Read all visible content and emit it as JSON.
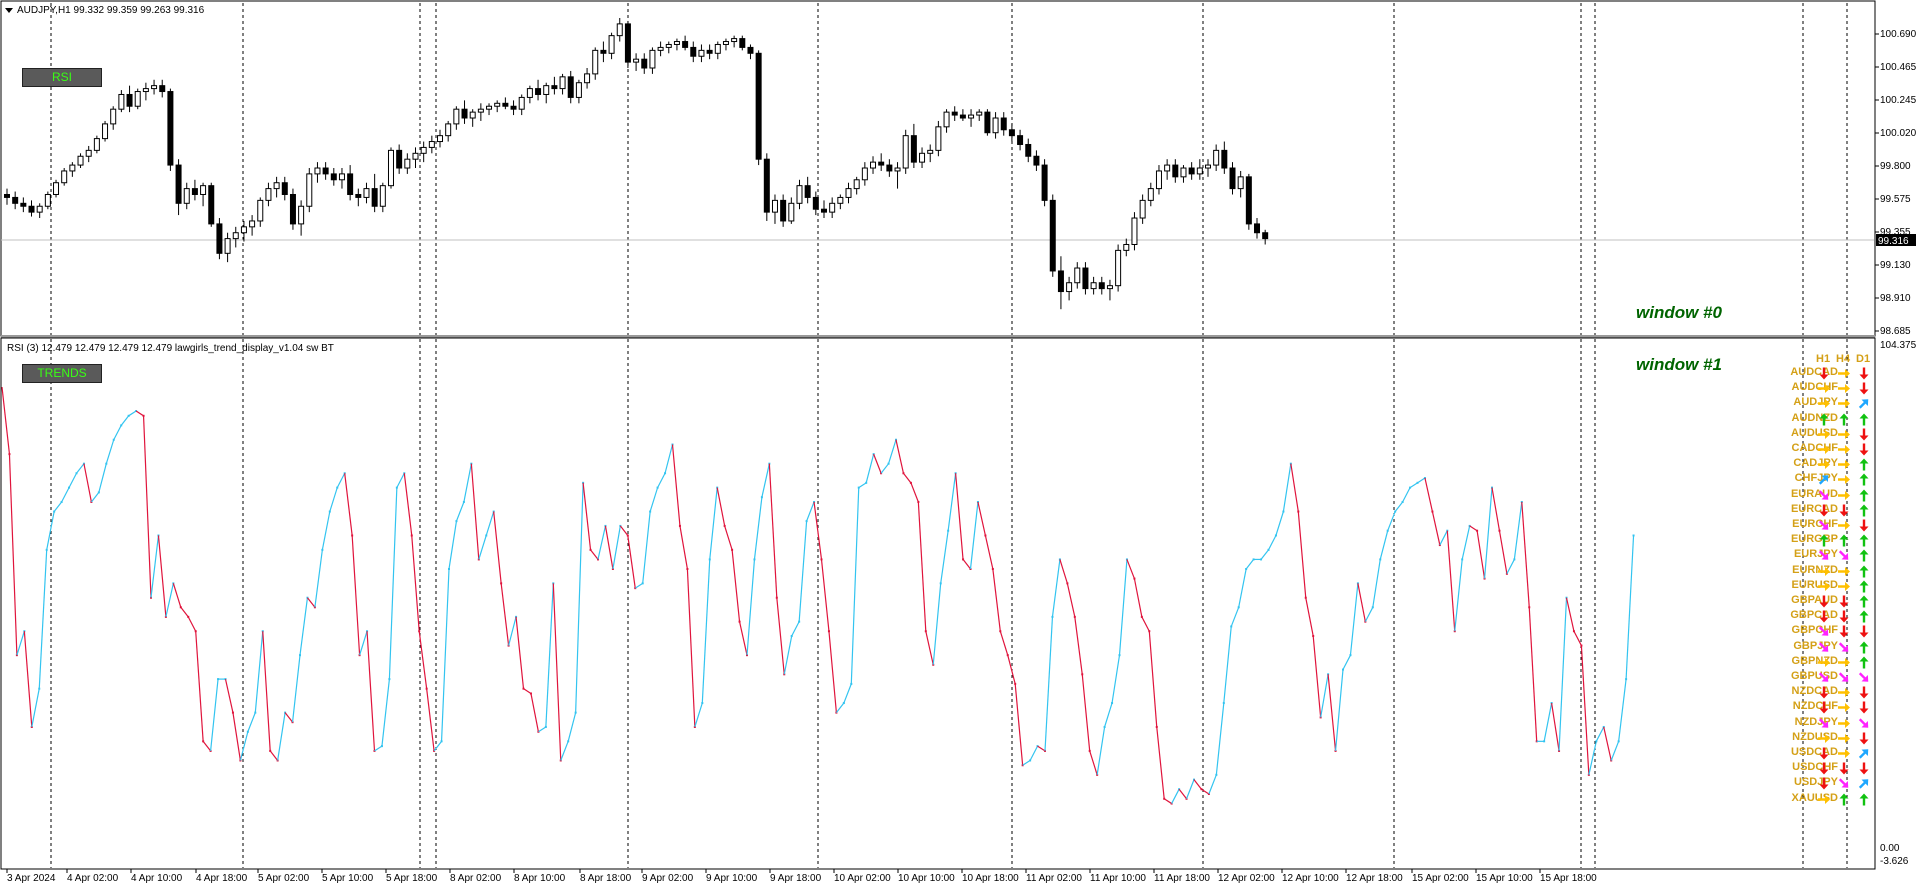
{
  "chart_title": "AUDJPY,H1  99.332 99.359 99.263 99.316",
  "indicator_title": "RSI (3) 12.479 12.479 12.479 12.479  lawgirls_trend_display_v1.04 sw BT",
  "buttons": {
    "rsi": "RSI",
    "trends": "TRENDS"
  },
  "windows": {
    "main": "window #0",
    "sub": "window #1"
  },
  "price_axis": {
    "labels": [
      "100.690",
      "100.465",
      "100.245",
      "100.020",
      "99.800",
      "99.575",
      "99.355",
      "99.130",
      "98.910",
      "98.685"
    ],
    "current_price": "99.316"
  },
  "rsi_axis": {
    "top": "104.375",
    "zero": "0.00",
    "bottom": "-3.626"
  },
  "time_axis": [
    "3 Apr 2024",
    "4 Apr 02:00",
    "4 Apr 10:00",
    "4 Apr 18:00",
    "5 Apr 02:00",
    "5 Apr 10:00",
    "5 Apr 18:00",
    "8 Apr 02:00",
    "8 Apr 10:00",
    "8 Apr 18:00",
    "9 Apr 02:00",
    "9 Apr 10:00",
    "9 Apr 18:00",
    "10 Apr 02:00",
    "10 Apr 10:00",
    "10 Apr 18:00",
    "11 Apr 02:00",
    "11 Apr 10:00",
    "11 Apr 18:00",
    "12 Apr 02:00",
    "12 Apr 10:00",
    "12 Apr 18:00",
    "15 Apr 02:00",
    "15 Apr 10:00",
    "15 Apr 18:00"
  ],
  "trend_panel": {
    "headers": [
      "H1",
      "H4",
      "D1"
    ],
    "rows": [
      {
        "symbol": "AUDCAD",
        "arrows": [
          "down",
          "right",
          "down"
        ]
      },
      {
        "symbol": "AUDCHF",
        "arrows": [
          "right",
          "right",
          "down"
        ]
      },
      {
        "symbol": "AUDJPY",
        "arrows": [
          "right",
          "right",
          "up-right"
        ]
      },
      {
        "symbol": "AUDNZD",
        "arrows": [
          "up",
          "up",
          "up"
        ]
      },
      {
        "symbol": "AUDUSD",
        "arrows": [
          "right",
          "right",
          "down"
        ]
      },
      {
        "symbol": "CADCHF",
        "arrows": [
          "right",
          "right",
          "down"
        ]
      },
      {
        "symbol": "CADJPY",
        "arrows": [
          "right",
          "right",
          "up"
        ]
      },
      {
        "symbol": "CHFJPY",
        "arrows": [
          "up-right",
          "right",
          "up"
        ]
      },
      {
        "symbol": "EURAUD",
        "arrows": [
          "down-right",
          "right",
          "up"
        ]
      },
      {
        "symbol": "EURCAD",
        "arrows": [
          "down",
          "down",
          "up"
        ]
      },
      {
        "symbol": "EURCHF",
        "arrows": [
          "down-right",
          "right",
          "down"
        ]
      },
      {
        "symbol": "EURGBP",
        "arrows": [
          "up",
          "up",
          "up"
        ]
      },
      {
        "symbol": "EURJPY",
        "arrows": [
          "down-right",
          "down-right",
          "up"
        ]
      },
      {
        "symbol": "EURNZD",
        "arrows": [
          "right",
          "right",
          "up"
        ]
      },
      {
        "symbol": "EURUSD",
        "arrows": [
          "right",
          "right",
          "up"
        ]
      },
      {
        "symbol": "GBPAUD",
        "arrows": [
          "down",
          "down",
          "up"
        ]
      },
      {
        "symbol": "GBPCAD",
        "arrows": [
          "down",
          "down",
          "up"
        ]
      },
      {
        "symbol": "GBPCHF",
        "arrows": [
          "down-right",
          "down",
          "down"
        ]
      },
      {
        "symbol": "GBPJPY",
        "arrows": [
          "down-right",
          "down-right",
          "up"
        ]
      },
      {
        "symbol": "GBPNZD",
        "arrows": [
          "right",
          "right",
          "up"
        ]
      },
      {
        "symbol": "GBPUSD",
        "arrows": [
          "down-right",
          "down-right",
          "down-right"
        ]
      },
      {
        "symbol": "NZDCAD",
        "arrows": [
          "down",
          "right",
          "down"
        ]
      },
      {
        "symbol": "NZDCHF",
        "arrows": [
          "down",
          "right",
          "down"
        ]
      },
      {
        "symbol": "NZDJPY",
        "arrows": [
          "down-right",
          "right",
          "down-right"
        ]
      },
      {
        "symbol": "NZDUSD",
        "arrows": [
          "right",
          "right",
          "down"
        ]
      },
      {
        "symbol": "USDCAD",
        "arrows": [
          "down",
          "right",
          "up-right"
        ]
      },
      {
        "symbol": "USDCHF",
        "arrows": [
          "down",
          "down",
          "down"
        ]
      },
      {
        "symbol": "USDJPY",
        "arrows": [
          "down",
          "down-right",
          "up-right"
        ]
      },
      {
        "symbol": "XAUUSD",
        "arrows": [
          "right",
          "up",
          "up"
        ]
      }
    ]
  },
  "colors": {
    "up": "#11c211",
    "down": "#ee1111",
    "right": "#ffc000",
    "up-right": "#1ea7ff",
    "down-right": "#ff22ff",
    "rsi_up": "#33c4f0",
    "rsi_down": "#e0143c"
  },
  "chart_data": {
    "type": "candlestick",
    "price_ylim": [
      98.685,
      100.82
    ],
    "rsi_ylim": [
      -3.626,
      104.375
    ],
    "candles": [
      [
        99.62,
        99.66,
        99.55,
        99.6
      ],
      [
        99.6,
        99.64,
        99.52,
        99.56
      ],
      [
        99.56,
        99.6,
        99.5,
        99.54
      ],
      [
        99.54,
        99.58,
        99.47,
        99.5
      ],
      [
        99.5,
        99.56,
        99.46,
        99.54
      ],
      [
        99.54,
        99.64,
        99.52,
        99.62
      ],
      [
        99.62,
        99.72,
        99.6,
        99.7
      ],
      [
        99.7,
        99.8,
        99.68,
        99.78
      ],
      [
        99.78,
        99.84,
        99.74,
        99.82
      ],
      [
        99.82,
        99.9,
        99.8,
        99.88
      ],
      [
        99.88,
        99.95,
        99.84,
        99.92
      ],
      [
        99.92,
        100.02,
        99.9,
        100.0
      ],
      [
        100.0,
        100.12,
        99.98,
        100.1
      ],
      [
        100.1,
        100.22,
        100.06,
        100.2
      ],
      [
        100.2,
        100.33,
        100.18,
        100.3
      ],
      [
        100.3,
        100.36,
        100.18,
        100.22
      ],
      [
        100.22,
        100.34,
        100.2,
        100.32
      ],
      [
        100.32,
        100.38,
        100.26,
        100.34
      ],
      [
        100.34,
        100.4,
        100.3,
        100.36
      ],
      [
        100.36,
        100.4,
        100.28,
        100.32
      ],
      [
        100.32,
        100.34,
        99.78,
        99.82
      ],
      [
        99.82,
        99.86,
        99.48,
        99.56
      ],
      [
        99.56,
        99.7,
        99.52,
        99.66
      ],
      [
        99.66,
        99.72,
        99.58,
        99.62
      ],
      [
        99.62,
        99.7,
        99.54,
        99.68
      ],
      [
        99.68,
        99.7,
        99.4,
        99.42
      ],
      [
        99.42,
        99.46,
        99.18,
        99.22
      ],
      [
        99.22,
        99.36,
        99.16,
        99.32
      ],
      [
        99.32,
        99.4,
        99.26,
        99.36
      ],
      [
        99.36,
        99.44,
        99.3,
        99.4
      ],
      [
        99.4,
        99.48,
        99.34,
        99.44
      ],
      [
        99.44,
        99.6,
        99.4,
        99.58
      ],
      [
        99.58,
        99.7,
        99.54,
        99.66
      ],
      [
        99.66,
        99.74,
        99.6,
        99.7
      ],
      [
        99.7,
        99.74,
        99.58,
        99.62
      ],
      [
        99.62,
        99.66,
        99.38,
        99.42
      ],
      [
        99.42,
        99.58,
        99.34,
        99.54
      ],
      [
        99.54,
        99.8,
        99.5,
        99.76
      ],
      [
        99.76,
        99.84,
        99.7,
        99.8
      ],
      [
        99.8,
        99.84,
        99.72,
        99.76
      ],
      [
        99.76,
        99.8,
        99.68,
        99.72
      ],
      [
        99.72,
        99.8,
        99.66,
        99.76
      ],
      [
        99.76,
        99.82,
        99.58,
        99.62
      ],
      [
        99.62,
        99.66,
        99.54,
        99.6
      ],
      [
        99.6,
        99.7,
        99.56,
        99.66
      ],
      [
        99.66,
        99.76,
        99.5,
        99.54
      ],
      [
        99.54,
        99.7,
        99.5,
        99.68
      ],
      [
        99.68,
        99.94,
        99.66,
        99.92
      ],
      [
        99.92,
        99.96,
        99.76,
        99.8
      ],
      [
        99.8,
        99.9,
        99.76,
        99.86
      ],
      [
        99.86,
        99.94,
        99.8,
        99.9
      ],
      [
        99.9,
        99.98,
        99.84,
        99.94
      ],
      [
        99.94,
        100.02,
        99.9,
        99.98
      ],
      [
        99.98,
        100.06,
        99.94,
        100.02
      ],
      [
        100.02,
        100.12,
        99.98,
        100.1
      ],
      [
        100.1,
        100.22,
        100.06,
        100.2
      ],
      [
        100.2,
        100.26,
        100.1,
        100.14
      ],
      [
        100.14,
        100.2,
        100.08,
        100.18
      ],
      [
        100.18,
        100.24,
        100.12,
        100.2
      ],
      [
        100.2,
        100.24,
        100.16,
        100.22
      ],
      [
        100.22,
        100.26,
        100.18,
        100.24
      ],
      [
        100.24,
        100.28,
        100.2,
        100.22
      ],
      [
        100.22,
        100.26,
        100.16,
        100.2
      ],
      [
        100.2,
        100.3,
        100.16,
        100.28
      ],
      [
        100.28,
        100.36,
        100.24,
        100.34
      ],
      [
        100.34,
        100.4,
        100.26,
        100.3
      ],
      [
        100.3,
        100.38,
        100.24,
        100.36
      ],
      [
        100.36,
        100.42,
        100.3,
        100.34
      ],
      [
        100.34,
        100.44,
        100.3,
        100.42
      ],
      [
        100.42,
        100.46,
        100.24,
        100.28
      ],
      [
        100.28,
        100.4,
        100.24,
        100.38
      ],
      [
        100.38,
        100.48,
        100.34,
        100.44
      ],
      [
        100.44,
        100.62,
        100.4,
        100.6
      ],
      [
        100.6,
        100.66,
        100.52,
        100.58
      ],
      [
        100.58,
        100.72,
        100.54,
        100.7
      ],
      [
        100.7,
        100.82,
        100.66,
        100.78
      ],
      [
        100.78,
        100.8,
        100.48,
        100.52
      ],
      [
        100.52,
        100.58,
        100.46,
        100.54
      ],
      [
        100.54,
        100.58,
        100.44,
        100.48
      ],
      [
        100.48,
        100.62,
        100.44,
        100.6
      ],
      [
        100.6,
        100.66,
        100.56,
        100.62
      ],
      [
        100.62,
        100.66,
        100.58,
        100.64
      ],
      [
        100.64,
        100.68,
        100.6,
        100.66
      ],
      [
        100.66,
        100.7,
        100.6,
        100.62
      ],
      [
        100.62,
        100.66,
        100.52,
        100.56
      ],
      [
        100.56,
        100.64,
        100.52,
        100.6
      ],
      [
        100.6,
        100.64,
        100.54,
        100.58
      ],
      [
        100.58,
        100.66,
        100.54,
        100.64
      ],
      [
        100.64,
        100.68,
        100.6,
        100.66
      ],
      [
        100.66,
        100.7,
        100.62,
        100.68
      ],
      [
        100.68,
        100.7,
        100.6,
        100.62
      ],
      [
        100.62,
        100.64,
        100.54,
        100.58
      ],
      [
        100.58,
        100.6,
        99.82,
        99.86
      ],
      [
        99.86,
        99.9,
        99.44,
        99.5
      ],
      [
        99.5,
        99.62,
        99.42,
        99.58
      ],
      [
        99.58,
        99.62,
        99.4,
        99.44
      ],
      [
        99.44,
        99.6,
        99.42,
        99.56
      ],
      [
        99.56,
        99.72,
        99.52,
        99.68
      ],
      [
        99.68,
        99.74,
        99.56,
        99.6
      ],
      [
        99.6,
        99.64,
        99.48,
        99.52
      ],
      [
        99.52,
        99.58,
        99.46,
        99.5
      ],
      [
        99.5,
        99.6,
        99.46,
        99.56
      ],
      [
        99.56,
        99.62,
        99.52,
        99.6
      ],
      [
        99.6,
        99.7,
        99.56,
        99.66
      ],
      [
        99.66,
        99.74,
        99.62,
        99.72
      ],
      [
        99.72,
        99.84,
        99.68,
        99.8
      ],
      [
        99.8,
        99.88,
        99.76,
        99.84
      ],
      [
        99.84,
        99.9,
        99.78,
        99.82
      ],
      [
        99.82,
        99.86,
        99.74,
        99.78
      ],
      [
        99.78,
        99.84,
        99.66,
        99.8
      ],
      [
        99.8,
        100.06,
        99.76,
        100.02
      ],
      [
        100.02,
        100.1,
        99.8,
        99.84
      ],
      [
        99.84,
        99.94,
        99.8,
        99.9
      ],
      [
        99.9,
        99.96,
        99.84,
        99.92
      ],
      [
        99.92,
        100.12,
        99.88,
        100.08
      ],
      [
        100.08,
        100.2,
        100.04,
        100.18
      ],
      [
        100.18,
        100.22,
        100.12,
        100.16
      ],
      [
        100.16,
        100.2,
        100.12,
        100.14
      ],
      [
        100.14,
        100.2,
        100.08,
        100.16
      ],
      [
        100.16,
        100.2,
        100.12,
        100.18
      ],
      [
        100.18,
        100.2,
        100.02,
        100.04
      ],
      [
        100.04,
        100.18,
        100.0,
        100.14
      ],
      [
        100.14,
        100.18,
        100.02,
        100.06
      ],
      [
        100.06,
        100.1,
        99.98,
        100.02
      ],
      [
        100.02,
        100.06,
        99.92,
        99.96
      ],
      [
        99.96,
        100.0,
        99.84,
        99.88
      ],
      [
        99.88,
        99.92,
        99.78,
        99.82
      ],
      [
        99.82,
        99.86,
        99.54,
        99.58
      ],
      [
        99.58,
        99.62,
        99.06,
        99.1
      ],
      [
        99.1,
        99.2,
        98.84,
        98.96
      ],
      [
        98.96,
        99.06,
        98.9,
        99.02
      ],
      [
        99.02,
        99.16,
        98.98,
        99.12
      ],
      [
        99.12,
        99.16,
        98.94,
        98.98
      ],
      [
        98.98,
        99.06,
        98.94,
        99.02
      ],
      [
        99.02,
        99.06,
        98.94,
        98.98
      ],
      [
        98.98,
        99.04,
        98.9,
        99.0
      ],
      [
        99.0,
        99.28,
        98.96,
        99.24
      ],
      [
        99.24,
        99.32,
        99.2,
        99.28
      ],
      [
        99.28,
        99.5,
        99.24,
        99.46
      ],
      [
        99.46,
        99.62,
        99.42,
        99.58
      ],
      [
        99.58,
        99.7,
        99.54,
        99.66
      ],
      [
        99.66,
        99.82,
        99.62,
        99.78
      ],
      [
        99.78,
        99.86,
        99.72,
        99.82
      ],
      [
        99.82,
        99.86,
        99.7,
        99.74
      ],
      [
        99.74,
        99.82,
        99.7,
        99.8
      ],
      [
        99.8,
        99.84,
        99.72,
        99.76
      ],
      [
        99.76,
        99.86,
        99.72,
        99.8
      ],
      [
        99.8,
        99.86,
        99.74,
        99.82
      ],
      [
        99.82,
        99.96,
        99.78,
        99.92
      ],
      [
        99.92,
        99.98,
        99.76,
        99.8
      ],
      [
        99.8,
        99.84,
        99.62,
        99.66
      ],
      [
        99.66,
        99.78,
        99.6,
        99.74
      ],
      [
        99.74,
        99.76,
        99.38,
        99.42
      ],
      [
        99.42,
        99.46,
        99.32,
        99.36
      ],
      [
        99.36,
        99.38,
        99.28,
        99.32
      ]
    ],
    "rsi": [
      96,
      82,
      40,
      45,
      25,
      33,
      62,
      70,
      72,
      75,
      78,
      80,
      72,
      74,
      80,
      85,
      88,
      90,
      91,
      90,
      52,
      65,
      48,
      55,
      50,
      48,
      45,
      22,
      20,
      35,
      35,
      28,
      18,
      24,
      28,
      45,
      20,
      18,
      28,
      26,
      40,
      52,
      50,
      62,
      70,
      75,
      78,
      65,
      40,
      45,
      20,
      21,
      35,
      75,
      78,
      65,
      45,
      33,
      20,
      22,
      58,
      68,
      72,
      80,
      60,
      65,
      70,
      55,
      42,
      48,
      33,
      32,
      24,
      25,
      55,
      18,
      22,
      28,
      76,
      62,
      60,
      67,
      58,
      67,
      65,
      54,
      55,
      70,
      75,
      78,
      84,
      67,
      58,
      25,
      30,
      60,
      75,
      67,
      62,
      47,
      40,
      60,
      73,
      80,
      52,
      36,
      44,
      47,
      68,
      72,
      60,
      45,
      28,
      30,
      34,
      75,
      76,
      82,
      78,
      80,
      85,
      78,
      76,
      72,
      45,
      38,
      55,
      66,
      78,
      60,
      58,
      72,
      65,
      58,
      45,
      40,
      34,
      17,
      18,
      21,
      20,
      48,
      60,
      55,
      48,
      36,
      20,
      15,
      25,
      30,
      40,
      60,
      56,
      48,
      45,
      25,
      10,
      9,
      12,
      10,
      14,
      12,
      11,
      15,
      30,
      46,
      50,
      58,
      60,
      60,
      62,
      65,
      70,
      80,
      70,
      52,
      44,
      27,
      36,
      20,
      37,
      40,
      55,
      47,
      50,
      60,
      66,
      70,
      72,
      75,
      76,
      77,
      70,
      63,
      66,
      45,
      60,
      67,
      66,
      56,
      75,
      66,
      57,
      60,
      72,
      50,
      22,
      22,
      30,
      20,
      52,
      45,
      42,
      15,
      22,
      25,
      18,
      22,
      35,
      65
    ]
  }
}
